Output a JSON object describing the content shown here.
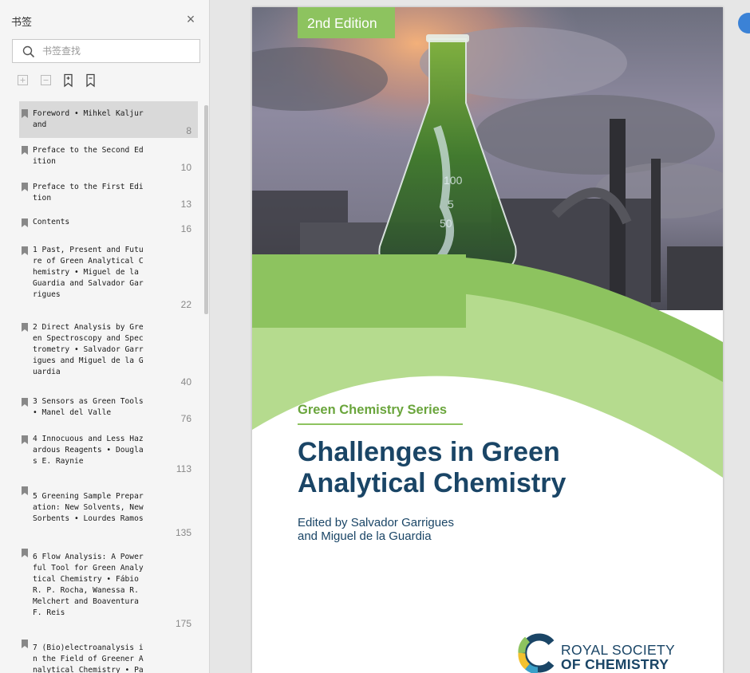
{
  "sidebar": {
    "title": "书签",
    "close_icon": "close-icon",
    "search": {
      "placeholder": "书签查找",
      "value": ""
    },
    "toolbar": [
      "expand-all-icon",
      "collapse-all-icon",
      "add-bookmark-icon",
      "bookmark-icon"
    ],
    "bookmarks": [
      {
        "text": "Foreword • Mihkel Kaljur\nand",
        "page": "8",
        "selected": true
      },
      {
        "text": "Preface to the Second Ed\nition",
        "page": "10"
      },
      {
        "text": "Preface to the First Edi\ntion",
        "page": "13"
      },
      {
        "text": "Contents",
        "page": "16"
      },
      {
        "text": "1 Past, Present and Futu\nre of Green Analytical C\nhemistry • Miguel de la\nGuardia and Salvador Gar\nrigues",
        "page": "22"
      },
      {
        "text": "2 Direct Analysis by Gre\nen Spectroscopy and Spec\ntrometry • Salvador Garr\nigues and Miguel de la G\nuardia",
        "page": "40"
      },
      {
        "text": "3 Sensors as Green Tools\n• Manel del Valle",
        "page": "76"
      },
      {
        "text": "4 Innocuous and Less Haz\nardous Reagents • Dougla\ns E. Raynie",
        "page": "113"
      },
      {
        "text": "5 Greening Sample Prepar\nation: New Solvents, New\nSorbents • Lourdes Ramos",
        "page": "135"
      },
      {
        "text": "6 Flow Analysis: A Power\nful Tool for Green Analy\ntical Chemistry • Fábio\nR. P. Rocha, Wanessa R.\nMelchert and Boaventura\nF. Reis",
        "page": "175"
      },
      {
        "text": "7 (Bio)electroanalysis i\nn the Field of Greener A\nnalytical Chemistry • Pa",
        "page": ""
      }
    ]
  },
  "cover": {
    "edition": "2nd Edition",
    "series": "Green Chemistry Series",
    "title_line1": "Challenges in Green",
    "title_line2": "Analytical Chemistry",
    "editors_line1": "Edited by Salvador Garrigues",
    "editors_line2": "and Miguel de la Guardia",
    "publisher_line1": "ROYAL SOCIETY",
    "publisher_line2": "OF CHEMISTRY",
    "flask_marks": [
      "100",
      "5",
      "50"
    ]
  },
  "colors": {
    "green": "#8dc35f",
    "navy": "#1a4566",
    "sidebar_bg": "#f5f5f5",
    "accent_blue": "#3b82d6"
  }
}
